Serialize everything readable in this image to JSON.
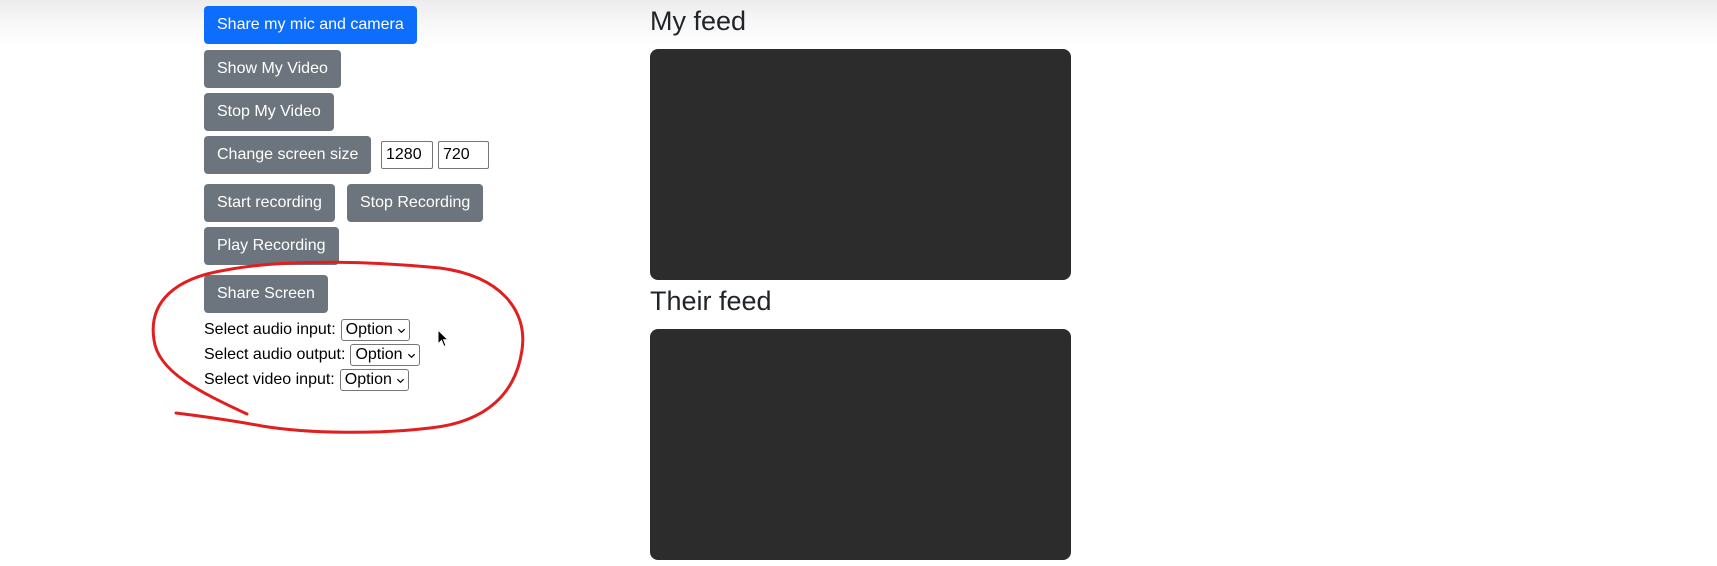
{
  "controls": {
    "share_mic_camera": "Share my mic and camera",
    "show_my_video": "Show My Video",
    "stop_my_video": "Stop My Video",
    "change_screen_size": "Change screen size",
    "width_value": "1280",
    "height_value": "720",
    "start_recording": "Start recording",
    "stop_recording": "Stop Recording",
    "play_recording": "Play Recording",
    "share_screen": "Share Screen"
  },
  "selects": [
    {
      "label": "Select audio input:",
      "value": "Option"
    },
    {
      "label": "Select audio output:",
      "value": "Option"
    },
    {
      "label": "Select video input:",
      "value": "Option"
    }
  ],
  "feeds": {
    "my_feed_title": "My feed",
    "their_feed_title": "Their feed"
  },
  "colors": {
    "primary": "#0d6efd",
    "secondary": "#6c757d",
    "video_bg": "#2c2c2c",
    "annotation": "#e02020"
  }
}
